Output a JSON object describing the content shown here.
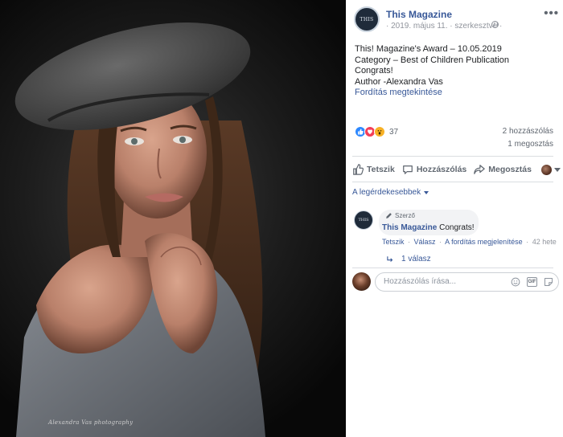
{
  "post": {
    "page_name": "This Magazine",
    "avatar_text": "THIS",
    "meta": "· 2019. május 11. · szerkesztve ·",
    "more_label": "•••",
    "lines": [
      "This! Magazine's Award – 10.05.2019",
      "Category – Best of Children Publication",
      "Congrats!",
      "Author -Alexandra Vas"
    ],
    "translate_link": "Fordítás megtekintése"
  },
  "photo": {
    "signature": "Alexandra Vas photography"
  },
  "stats": {
    "reaction_count": "37",
    "reactions": [
      "like-icon",
      "love-icon",
      "wow-icon"
    ],
    "comments": "2 hozzászólás",
    "shares": "1 megosztás"
  },
  "actions": {
    "like": "Tetszik",
    "comment": "Hozzászólás",
    "share": "Megosztás"
  },
  "comments": {
    "sort_label": "A legérdekesebbek",
    "items": [
      {
        "badge": "Szerző",
        "author": "This Magazine",
        "text": "Congrats!",
        "avatar_text": "THIS",
        "like": "Tetszik",
        "reply": "Válasz",
        "translation": "A fordítás megjelenítése",
        "time": "42 hete",
        "replies": "1 válasz"
      }
    ]
  },
  "composer": {
    "placeholder": "Hozzászólás írása..."
  },
  "colors": {
    "link": "#385898",
    "secondary_text": "#606770",
    "like": "#2d88ff",
    "love": "#f33e58",
    "wow": "#f7b125"
  }
}
